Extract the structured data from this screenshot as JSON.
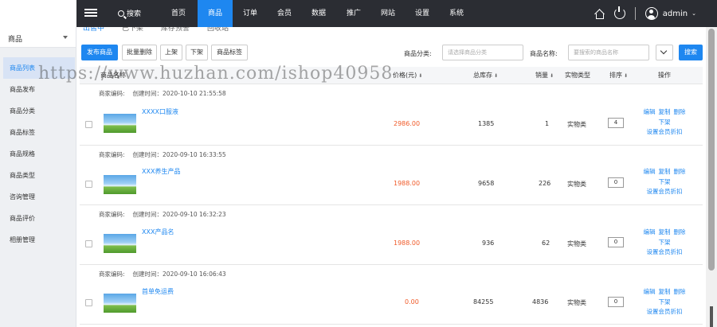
{
  "topbar": {
    "search_label": "搜索",
    "nav": [
      "首页",
      "商品",
      "订单",
      "会员",
      "数据",
      "推广",
      "网站",
      "设置",
      "系统"
    ],
    "active_index": 1,
    "user": "admin"
  },
  "sidebar": {
    "select_value": "商品",
    "items": [
      "商品列表",
      "商品发布",
      "商品分类",
      "商品标签",
      "商品规格",
      "商品类型",
      "咨询管理",
      "商品评价",
      "相册管理"
    ],
    "active_index": 0
  },
  "tabs": [
    "出售中",
    "已下架",
    "库存预警",
    "回收站"
  ],
  "toolbar": {
    "publish": "发布商品",
    "batch_delete": "批量删除",
    "on_shelf": "上架",
    "off_shelf": "下架",
    "tag": "商品标签",
    "category_label": "商品分类:",
    "category_placeholder": "请选择商品分类",
    "name_label": "商品名称:",
    "name_placeholder": "要搜索的商品名称",
    "search": "搜索"
  },
  "table": {
    "headers": {
      "name": "商品名称",
      "price": "价格(元)",
      "stock": "总库存",
      "sales": "销量",
      "type": "实物类型",
      "sort": "排序",
      "ops": "操作"
    },
    "rows": [
      {
        "code_label": "商家编码:",
        "created": "创建时间：2020-10-10 21:55:58",
        "name": "XXXX口服液",
        "price": "2986.00",
        "stock": "1385",
        "sales": "1",
        "type": "实物类",
        "sort": "4"
      },
      {
        "code_label": "商家编码:",
        "created": "创建时间：2020-09-10 16:33:55",
        "name": "XXX养生产品",
        "price": "1988.00",
        "stock": "9658",
        "sales": "226",
        "type": "实物类",
        "sort": "0"
      },
      {
        "code_label": "商家编码:",
        "created": "创建时间：2020-09-10 16:32:23",
        "name": "XXX产品名",
        "price": "1988.00",
        "stock": "936",
        "sales": "62",
        "type": "实物类",
        "sort": "0"
      },
      {
        "code_label": "商家编码:",
        "created": "创建时间：2020-09-10 16:06:43",
        "name": "首单免运费",
        "price": "0.00",
        "stock": "84255",
        "sales": "4836",
        "type": "实物类",
        "sort": "0"
      }
    ],
    "actions": {
      "edit": "编辑",
      "copy": "复制",
      "delete": "删除",
      "off": "下架",
      "member_discount": "设置会员折扣"
    }
  },
  "watermark": "https://www.huzhan.com/ishop40958",
  "colors": {
    "accent": "#1e87f0",
    "topbar": "#2b2d33",
    "price": "#f05a28"
  }
}
